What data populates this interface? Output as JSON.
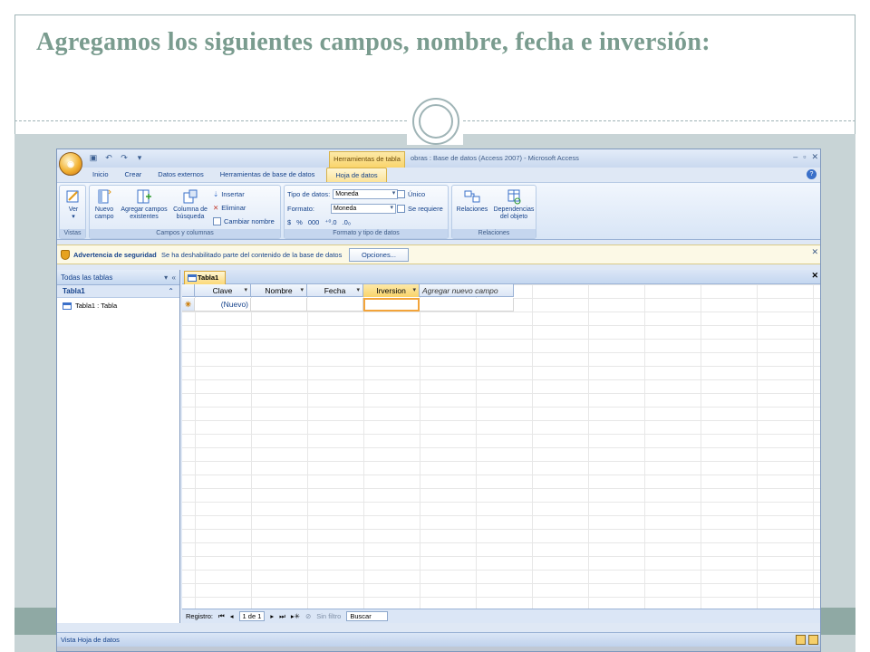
{
  "slide": {
    "title": "Agregamos los siguientes campos, nombre, fecha e inversión:"
  },
  "window": {
    "title": "obras : Base de datos (Access 2007) - Microsoft Access",
    "context_tab_header": "Herramientas de tabla",
    "office_button": "Office"
  },
  "ribbon": {
    "tabs": [
      "Inicio",
      "Crear",
      "Datos externos",
      "Herramientas de base de datos",
      "Hoja de datos"
    ],
    "active_tab": "Hoja de datos",
    "groups": {
      "vistas": {
        "label": "Vistas",
        "ver_label": "Ver"
      },
      "campos": {
        "label": "Campos y columnas",
        "nuevo_campo": "Nuevo campo",
        "agregar_campos": "Agregar campos existentes",
        "columna_busqueda": "Columna de búsqueda",
        "insertar": "Insertar",
        "eliminar": "Eliminar",
        "cambiar_nombre": "Cambiar nombre"
      },
      "formato": {
        "label": "Formato y tipo de datos",
        "tipo_label": "Tipo de datos:",
        "tipo_value": "Moneda",
        "formato_label": "Formato:",
        "formato_value": "Moneda",
        "unico": "Único",
        "se_requiere": "Se requiere",
        "currency_symbols": [
          "$",
          "%",
          "000",
          "⁺⁰.0",
          ".0₀"
        ]
      },
      "relaciones": {
        "label": "Relaciones",
        "relaciones": "Relaciones",
        "dependencias": "Dependencias del objeto"
      }
    }
  },
  "security": {
    "title": "Advertencia de seguridad",
    "message": "Se ha deshabilitado parte del contenido de la base de datos",
    "options_button": "Opciones..."
  },
  "nav_pane": {
    "header": "Todas las tablas",
    "group": "Tabla1",
    "items": [
      {
        "label": "Tabla1 : Tabla"
      }
    ]
  },
  "document": {
    "tab_label": "Tabla1",
    "columns": [
      {
        "label": "Clave",
        "width": 62
      },
      {
        "label": "Nombre",
        "width": 62
      },
      {
        "label": "Fecha",
        "width": 62
      },
      {
        "label": "Irversion",
        "width": 62
      },
      {
        "label": "Agregar nuevo campo",
        "width": 104
      }
    ],
    "new_row_marker": "✳",
    "new_row_value": "(Nuevo)"
  },
  "record_nav": {
    "label": "Registro:",
    "position": "1 de 1",
    "filter": "Sin filtro",
    "search": "Buscar"
  },
  "status": {
    "text": "Vista Hoja de datos"
  }
}
